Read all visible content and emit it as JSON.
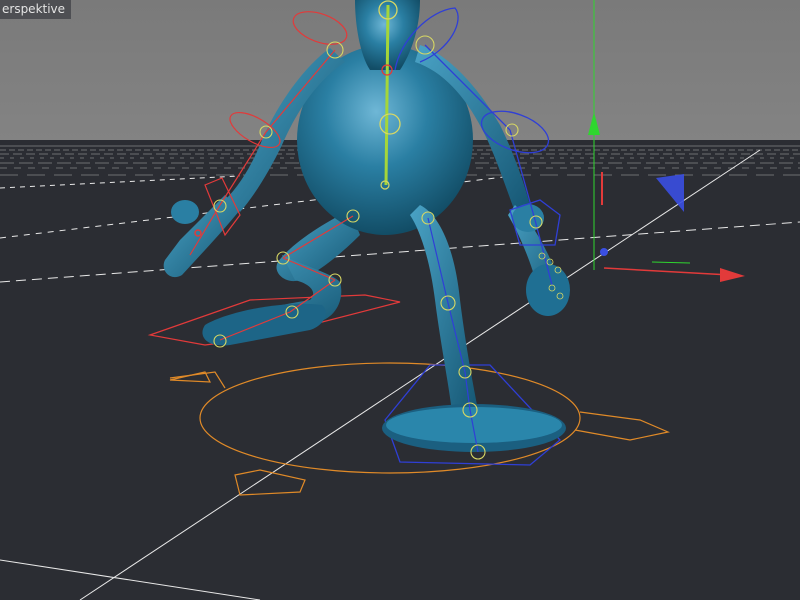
{
  "viewport": {
    "label": "erspektive",
    "background_top": "#808080",
    "background_floor": "#2b2e33"
  },
  "character": {
    "mesh_color": "#1f6f93",
    "joint_color": "#d8d864",
    "rig_colors": {
      "left_ik": "#e23a3a",
      "right_ik": "#2f3fd6",
      "spine": "#a4d63a"
    }
  },
  "gizmo": {
    "x_axis_color": "#e23a3a",
    "y_axis_color": "#2fd62f",
    "z_axis_color": "#3a4fe2",
    "ground_ring_color": "#e08a28"
  }
}
